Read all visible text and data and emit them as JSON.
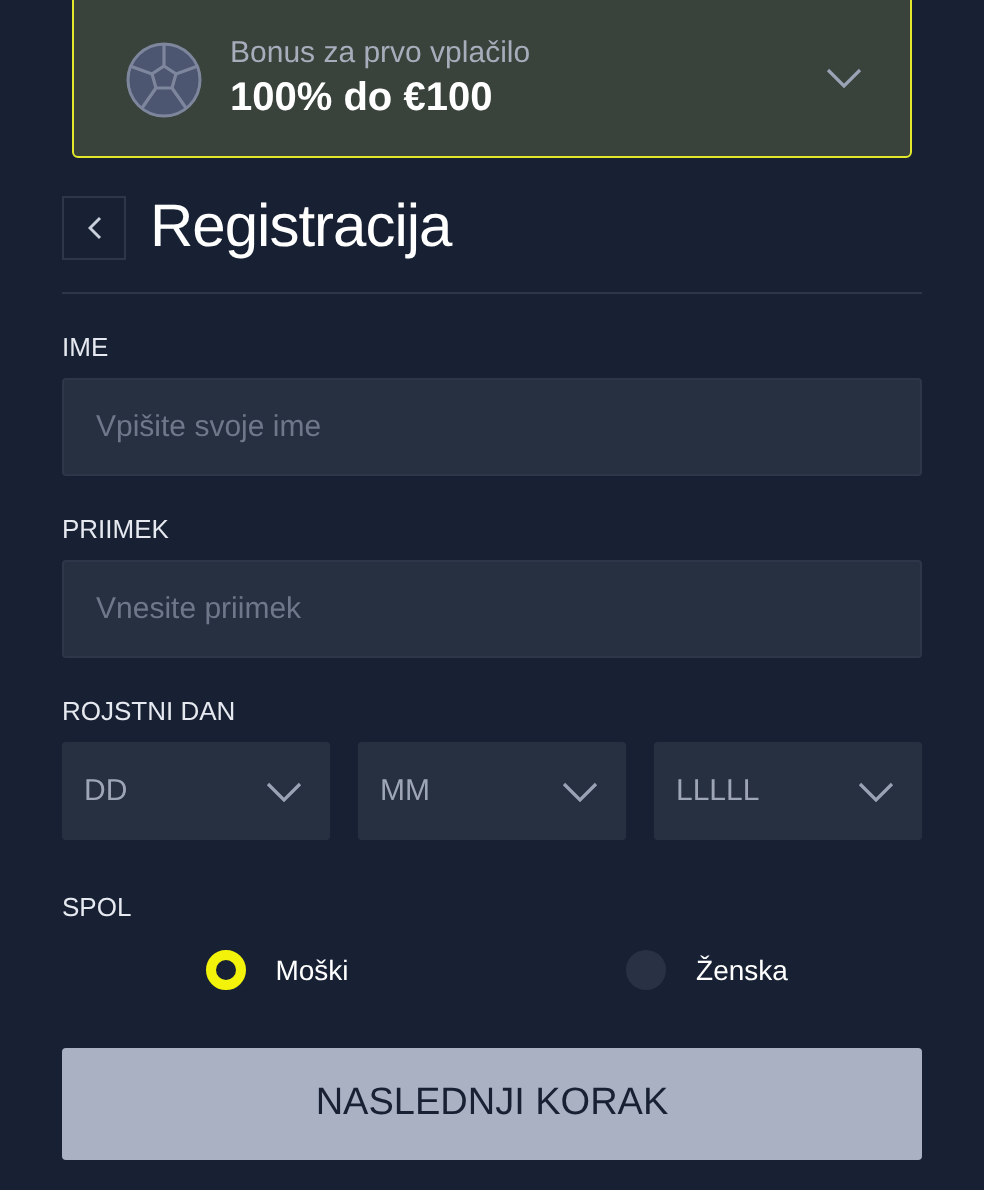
{
  "bonus": {
    "caption": "Bonus za prvo vplačilo",
    "offer": "100% do €100",
    "expanded": false
  },
  "header": {
    "title": "Registracija"
  },
  "fields": [
    {
      "label": "IME",
      "placeholder": "Vpišite svoje ime"
    },
    {
      "label": "PRIIMEK",
      "placeholder": "Vnesite priimek"
    }
  ],
  "birthday": {
    "label": "ROJSTNI DAN",
    "selects": [
      {
        "placeholder": "DD"
      },
      {
        "placeholder": "MM"
      },
      {
        "placeholder": "LLLLL"
      }
    ]
  },
  "gender": {
    "label": "SPOL",
    "options": [
      {
        "label": "Moški",
        "selected": true
      },
      {
        "label": "Ženska",
        "selected": false
      }
    ]
  },
  "next_button": {
    "label": "NASLEDNJI KORAK",
    "disabled": true
  }
}
